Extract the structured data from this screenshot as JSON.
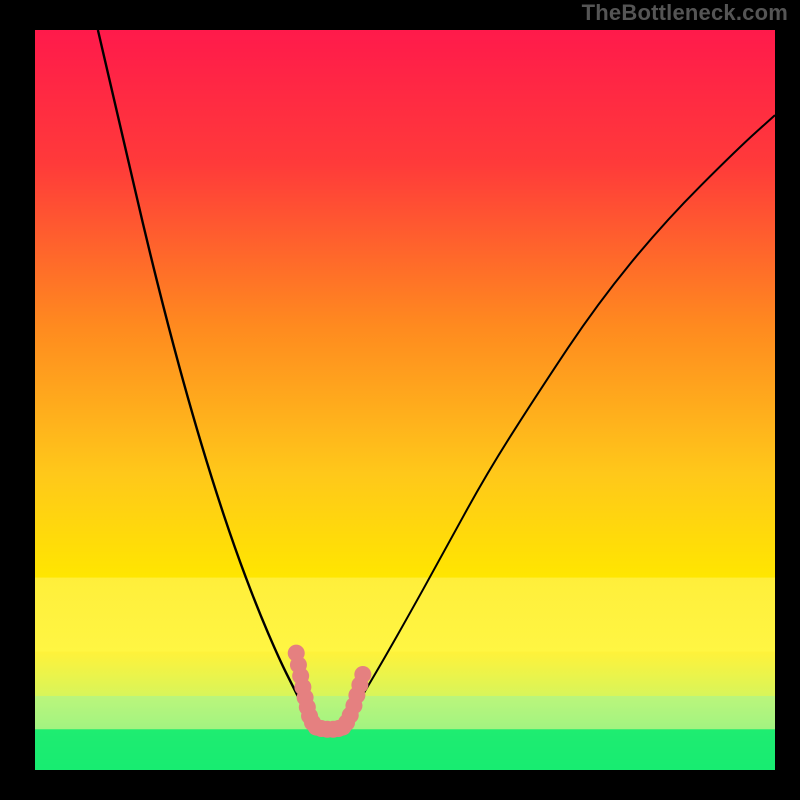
{
  "watermark": "TheBottleneck.com",
  "chart_data": {
    "type": "line",
    "title": "",
    "xlabel": "",
    "ylabel": "",
    "xlim": [
      0,
      100
    ],
    "ylim": [
      0,
      100
    ],
    "background_gradient": {
      "top_color": "#ff1a4b",
      "mid_color": "#ffe600",
      "bottom_color": "#00e76a"
    },
    "yellow_band": {
      "y0": 74,
      "y1": 84
    },
    "green_band": {
      "y0": 94.5,
      "y1": 100
    },
    "light_green_band": {
      "y0": 90,
      "y1": 94.5
    },
    "series": [
      {
        "name": "left_curve",
        "x": [
          8.5,
          12,
          15,
          18,
          21,
          24,
          27,
          30,
          33,
          35,
          36.5,
          37.5,
          38.3
        ],
        "y": [
          0,
          15,
          28,
          40,
          51,
          61,
          70,
          78,
          85,
          89,
          92,
          93.5,
          94.3
        ]
      },
      {
        "name": "right_curve",
        "x": [
          41.5,
          43,
          46,
          50,
          55,
          61,
          68,
          76,
          85,
          95,
          100
        ],
        "y": [
          94.3,
          92,
          87,
          80,
          71,
          60,
          49,
          37,
          26,
          16,
          11.5
        ]
      }
    ],
    "valley_marker": {
      "name": "valley_dots",
      "color": "#e58080",
      "points": [
        {
          "x": 35.3,
          "y": 84.2
        },
        {
          "x": 35.6,
          "y": 85.8
        },
        {
          "x": 35.9,
          "y": 87.3
        },
        {
          "x": 36.2,
          "y": 88.8
        },
        {
          "x": 36.5,
          "y": 90.2
        },
        {
          "x": 36.8,
          "y": 91.5
        },
        {
          "x": 37.1,
          "y": 92.7
        },
        {
          "x": 37.5,
          "y": 93.6
        },
        {
          "x": 38.0,
          "y": 94.2
        },
        {
          "x": 38.7,
          "y": 94.4
        },
        {
          "x": 39.5,
          "y": 94.5
        },
        {
          "x": 40.3,
          "y": 94.5
        },
        {
          "x": 41.0,
          "y": 94.4
        },
        {
          "x": 41.6,
          "y": 94.2
        },
        {
          "x": 42.1,
          "y": 93.6
        },
        {
          "x": 42.6,
          "y": 92.6
        },
        {
          "x": 43.1,
          "y": 91.3
        },
        {
          "x": 43.5,
          "y": 89.9
        },
        {
          "x": 43.9,
          "y": 88.5
        },
        {
          "x": 44.3,
          "y": 87.1
        }
      ]
    }
  }
}
